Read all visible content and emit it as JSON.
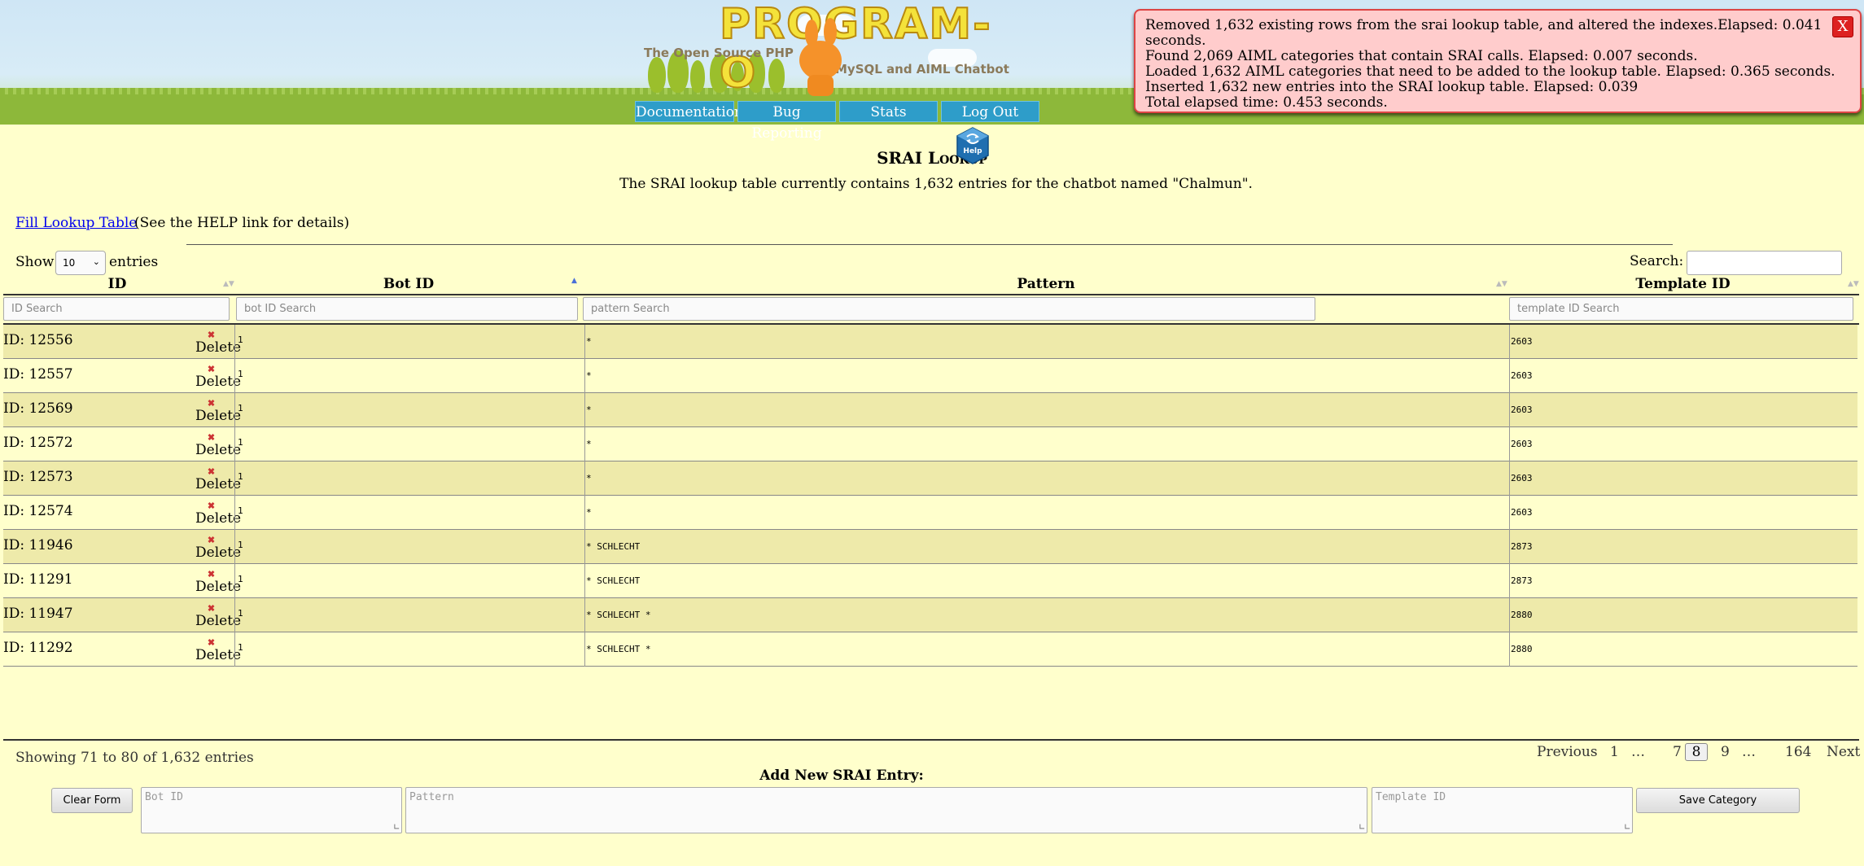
{
  "header": {
    "logo_title": "PROGRAM-O",
    "logo_sub1": "The Open Source PHP",
    "logo_sub2": "MySQL and AIML Chatbot",
    "nav": [
      "Documentation",
      "Bug Reporting",
      "Stats",
      "Log Out"
    ]
  },
  "message": {
    "lines": [
      "Removed 1,632 existing rows from the srai lookup table, and altered the indexes.Elapsed: 0.041",
      "seconds.",
      "Found 2,069 AIML categories that contain SRAI calls. Elapsed: 0.007 seconds.",
      "Loaded 1,632 AIML categories that need to be added to the lookup table. Elapsed: 0.365 seconds.",
      "Inserted 1,632 new entries into the SRAI lookup table. Elapsed: 0.039",
      "Total elapsed time: 0.453 seconds."
    ],
    "close_label": "X"
  },
  "page": {
    "title": "SRAI Lookup",
    "help_label": "Help",
    "description": "The SRAI lookup table currently contains 1,632 entries for the chatbot named \"Chalmun\".",
    "fill_link": "Fill Lookup Table",
    "fill_note": "(See the HELP link for details)"
  },
  "table": {
    "show_label": "Show",
    "page_size": "10",
    "entries_label": "entries",
    "search_label": "Search:",
    "columns": [
      "ID",
      "Bot ID",
      "Pattern",
      "Template ID"
    ],
    "filters": [
      "ID Search",
      "bot ID Search",
      "pattern Search",
      "template ID Search"
    ],
    "delete_label": "Delete",
    "rows": [
      {
        "id": "ID: 12556",
        "bot": "1",
        "pattern": "*",
        "template": "2603"
      },
      {
        "id": "ID: 12557",
        "bot": "1",
        "pattern": "*",
        "template": "2603"
      },
      {
        "id": "ID: 12569",
        "bot": "1",
        "pattern": "*",
        "template": "2603"
      },
      {
        "id": "ID: 12572",
        "bot": "1",
        "pattern": "*",
        "template": "2603"
      },
      {
        "id": "ID: 12573",
        "bot": "1",
        "pattern": "*",
        "template": "2603"
      },
      {
        "id": "ID: 12574",
        "bot": "1",
        "pattern": "*",
        "template": "2603"
      },
      {
        "id": "ID: 11946",
        "bot": "1",
        "pattern": "* SCHLECHT",
        "template": "2873"
      },
      {
        "id": "ID: 11291",
        "bot": "1",
        "pattern": "* SCHLECHT",
        "template": "2873"
      },
      {
        "id": "ID: 11947",
        "bot": "1",
        "pattern": "* SCHLECHT *",
        "template": "2880"
      },
      {
        "id": "ID: 11292",
        "bot": "1",
        "pattern": "* SCHLECHT *",
        "template": "2880"
      }
    ],
    "info": "Showing 71 to 80 of 1,632 entries",
    "pagination": {
      "previous": "Previous",
      "first": "1",
      "ellipsis1": "…",
      "p7": "7",
      "current": "8",
      "p9": "9",
      "ellipsis2": "…",
      "last": "164",
      "next": "Next"
    }
  },
  "add_form": {
    "title": "Add New SRAI Entry:",
    "clear_label": "Clear Form",
    "bot_placeholder": "Bot ID",
    "pattern_placeholder": "Pattern",
    "template_placeholder": "Template ID",
    "save_label": "Save Category"
  },
  "colors": {
    "background": "#ffffcc",
    "row_alt": "#eeeaaa",
    "nav": "#2e9dc9",
    "message_bg": "#ffcccc",
    "close_button": "#dd2020",
    "link": "#0000ee"
  }
}
